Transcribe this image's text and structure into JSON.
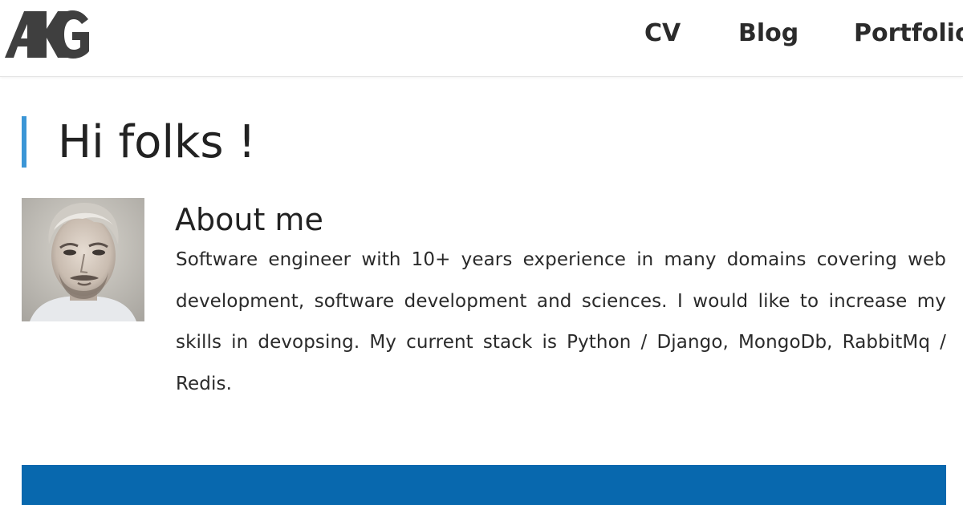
{
  "header": {
    "logo_text": "AKG",
    "nav": [
      {
        "label": "CV"
      },
      {
        "label": "Blog"
      },
      {
        "label": "Portfolio"
      }
    ]
  },
  "main": {
    "greeting": "Hi folks !",
    "about": {
      "title": "About me",
      "text": "Software engineer with 10+ years experience in many domains covering web development, software development and sciences. I would like to increase my skills in devopsing. My current stack is Python / Django, MongoDb, RabbitMq / Redis."
    }
  },
  "colors": {
    "accent_bar": "#3b96d6",
    "band": "#0868ae",
    "logo": "#3f3f3f",
    "text": "#222222"
  }
}
